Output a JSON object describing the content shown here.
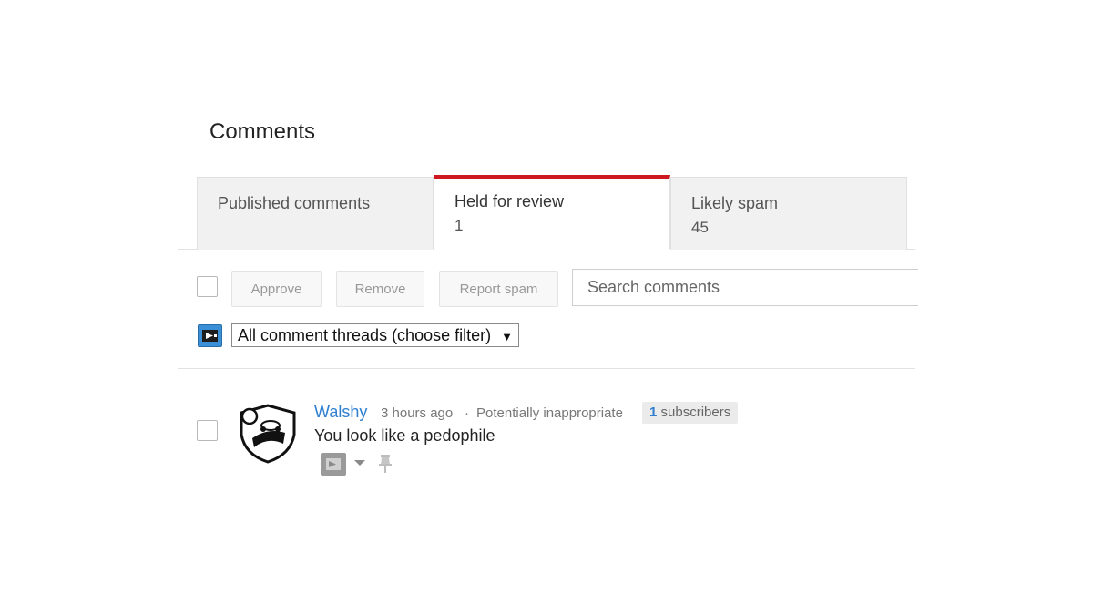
{
  "page": {
    "title": "Comments"
  },
  "tabs": [
    {
      "label": "Published comments",
      "count": ""
    },
    {
      "label": "Held for review",
      "count": "1"
    },
    {
      "label": "Likely spam",
      "count": "45"
    }
  ],
  "toolbar": {
    "approve_label": "Approve",
    "remove_label": "Remove",
    "report_spam_label": "Report spam",
    "search_placeholder": "Search comments"
  },
  "filter": {
    "selected": "All comment threads (choose filter)",
    "arrow": "▼"
  },
  "comment": {
    "author": "Walshy",
    "time": "3 hours ago",
    "separator": "·",
    "flag": "Potentially inappropriate",
    "subscriber_count": "1",
    "subscriber_label": "subscribers",
    "text": "You look like a pedophile"
  },
  "colors": {
    "active_tab_accent": "#cc181e",
    "link": "#2f7fd1",
    "filter_icon_bg": "#3a8fd6"
  }
}
